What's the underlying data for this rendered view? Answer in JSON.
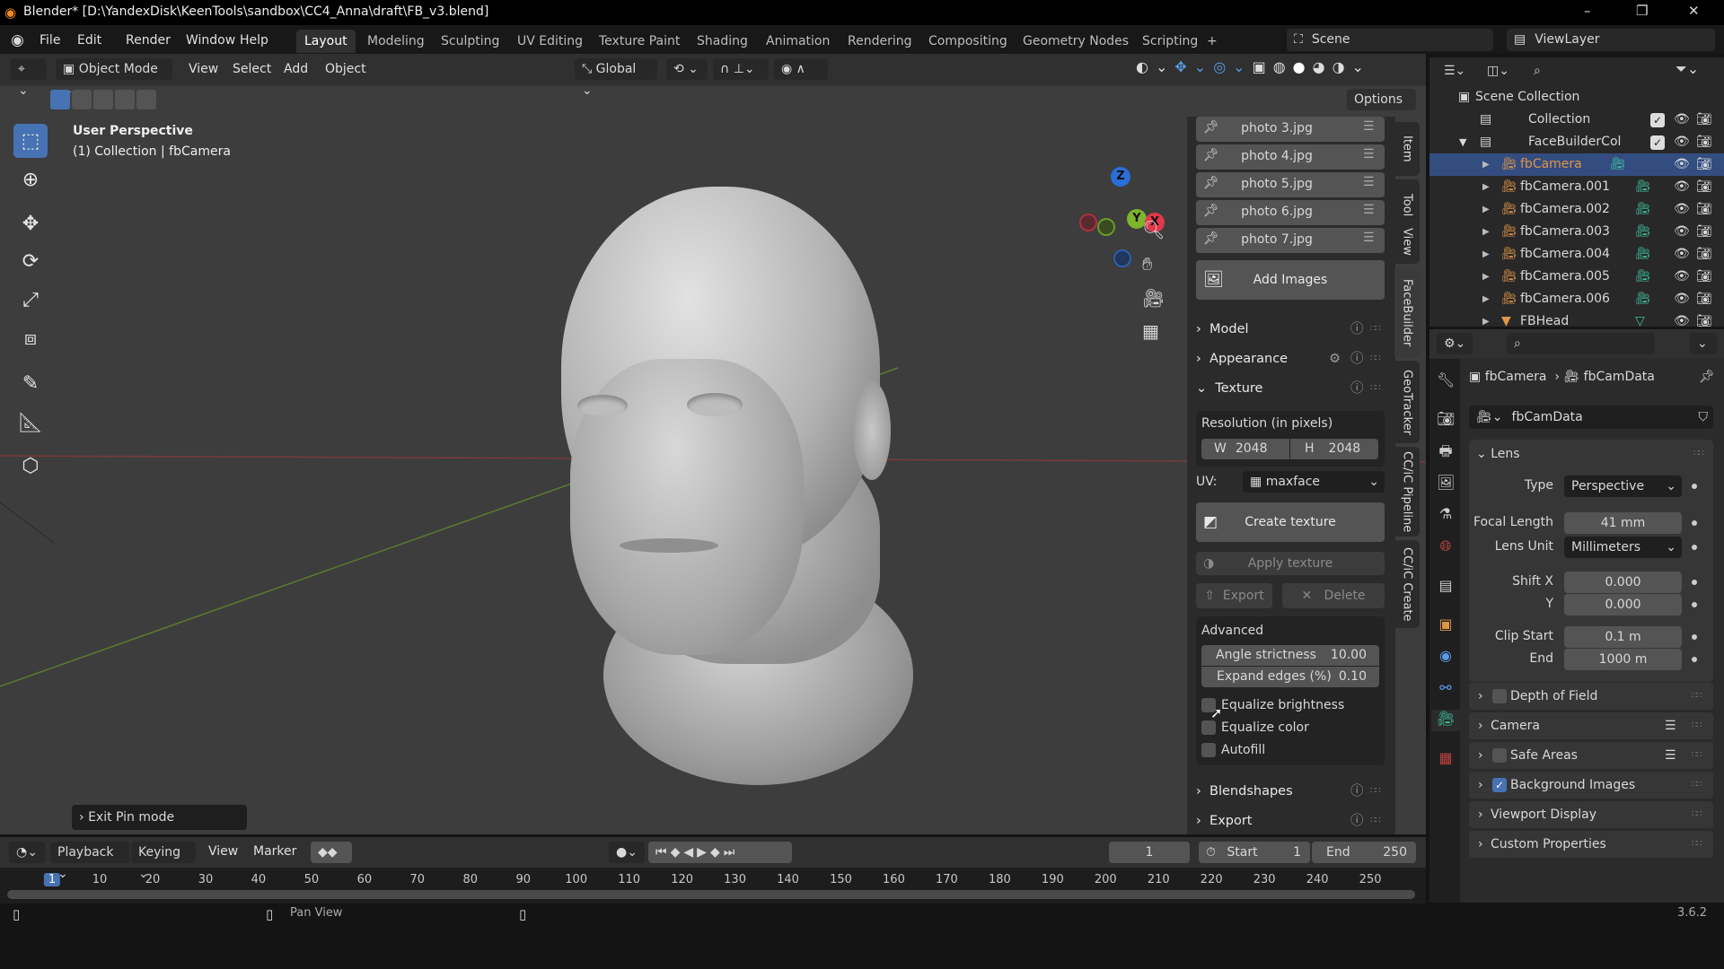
{
  "titlebar": {
    "title": "Blender* [D:\\YandexDisk\\KeenTools\\sandbox\\CC4_Anna\\draft\\FB_v3.blend]",
    "minimize": "–",
    "maximize": "❐",
    "close": "✕"
  },
  "menu": [
    "File",
    "Edit",
    "Render",
    "Window",
    "Help"
  ],
  "workspaces": [
    "Layout",
    "Modeling",
    "Sculpting",
    "UV Editing",
    "Texture Paint",
    "Shading",
    "Animation",
    "Rendering",
    "Compositing",
    "Geometry Nodes",
    "Scripting",
    "+"
  ],
  "active_workspace": "Layout",
  "scene": "Scene",
  "view_layer": "ViewLayer",
  "viewport": {
    "mode": "Object Mode",
    "menus": [
      "View",
      "Select",
      "Add",
      "Object"
    ],
    "orientation": "Global",
    "options": "Options",
    "overlay_title": "User Perspective",
    "overlay_sub": "(1) Collection | fbCamera",
    "exit_pin": "Exit Pin mode",
    "gizmo": {
      "x": "X",
      "y": "Y",
      "z": "Z"
    }
  },
  "npanel": {
    "photos": [
      "photo 3.jpg",
      "photo 4.jpg",
      "photo 5.jpg",
      "photo 6.jpg",
      "photo 7.jpg"
    ],
    "add_images": "Add Images",
    "model": "Model",
    "appearance": "Appearance",
    "texture": "Texture",
    "resolution_label": "Resolution (in pixels)",
    "w_label": "W",
    "w": "2048",
    "h_label": "H",
    "h": "2048",
    "uv_label": "UV:",
    "uv": "maxface",
    "create_texture": "Create texture",
    "apply_texture": "Apply texture",
    "export_btn": "Export",
    "delete_btn": "Delete",
    "advanced": "Advanced",
    "angle_label": "Angle strictness",
    "angle": "10.00",
    "expand_label": "Expand edges (%)",
    "expand": "0.10",
    "checks": [
      {
        "label": "Equalize brightness",
        "checked": false
      },
      {
        "label": "Equalize color",
        "checked": false
      },
      {
        "label": "Autofill",
        "checked": false
      }
    ],
    "blendshapes": "Blendshapes",
    "export": "Export",
    "tabs": [
      "Item",
      "Tool",
      "View",
      "FaceBuilder",
      "GeoTracker",
      "CC/iC Pipeline",
      "CC/iC Create"
    ],
    "active_tab": "FaceBuilder"
  },
  "outliner": {
    "root": "Scene Collection",
    "rows": [
      {
        "label": "Collection",
        "type": "collection"
      },
      {
        "label": "FaceBuilderCol",
        "type": "collection"
      },
      {
        "label": "fbCamera",
        "type": "camera",
        "selected": true
      },
      {
        "label": "fbCamera.001",
        "type": "camera"
      },
      {
        "label": "fbCamera.002",
        "type": "camera"
      },
      {
        "label": "fbCamera.003",
        "type": "camera"
      },
      {
        "label": "fbCamera.004",
        "type": "camera"
      },
      {
        "label": "fbCamera.005",
        "type": "camera"
      },
      {
        "label": "fbCamera.006",
        "type": "camera"
      },
      {
        "label": "FBHead",
        "type": "mesh"
      }
    ]
  },
  "properties": {
    "breadcrumb_object": "fbCamera",
    "breadcrumb_data": "fbCamData",
    "datablock": "fbCamData",
    "lens": "Lens",
    "rows": [
      {
        "label": "Type",
        "value": "Perspective",
        "kind": "drop"
      },
      {
        "label": "Focal Length",
        "value": "41 mm",
        "kind": "num"
      },
      {
        "label": "Lens Unit",
        "value": "Millimeters",
        "kind": "drop"
      },
      {
        "label": "Shift X",
        "value": "0.000",
        "kind": "num"
      },
      {
        "label": "Y",
        "value": "0.000",
        "kind": "num"
      },
      {
        "label": "Clip Start",
        "value": "0.1 m",
        "kind": "num"
      },
      {
        "label": "End",
        "value": "1000 m",
        "kind": "num"
      }
    ],
    "subpanels": [
      {
        "label": "Depth of Field",
        "check": false
      },
      {
        "label": "Camera"
      },
      {
        "label": "Safe Areas",
        "check": false
      },
      {
        "label": "Background Images",
        "check": true
      },
      {
        "label": "Viewport Display"
      },
      {
        "label": "Custom Properties"
      }
    ]
  },
  "timeline": {
    "menus": [
      "Playback",
      "Keying",
      "View",
      "Marker"
    ],
    "current_frame": "1",
    "start_label": "Start",
    "start": "1",
    "end_label": "End",
    "end": "250",
    "ticks": [
      "1",
      "10",
      "20",
      "30",
      "40",
      "50",
      "60",
      "70",
      "80",
      "90",
      "100",
      "110",
      "120",
      "130",
      "140",
      "150",
      "160",
      "170",
      "180",
      "190",
      "200",
      "210",
      "220",
      "230",
      "240",
      "250"
    ]
  },
  "statusbar": {
    "middle": "Pan View",
    "version": "3.6.2"
  },
  "colors": {
    "accent": "#4772b3",
    "camera_orange": "#e0944a",
    "data_green": "#3fbf9b",
    "selected_row": "#334d80"
  }
}
